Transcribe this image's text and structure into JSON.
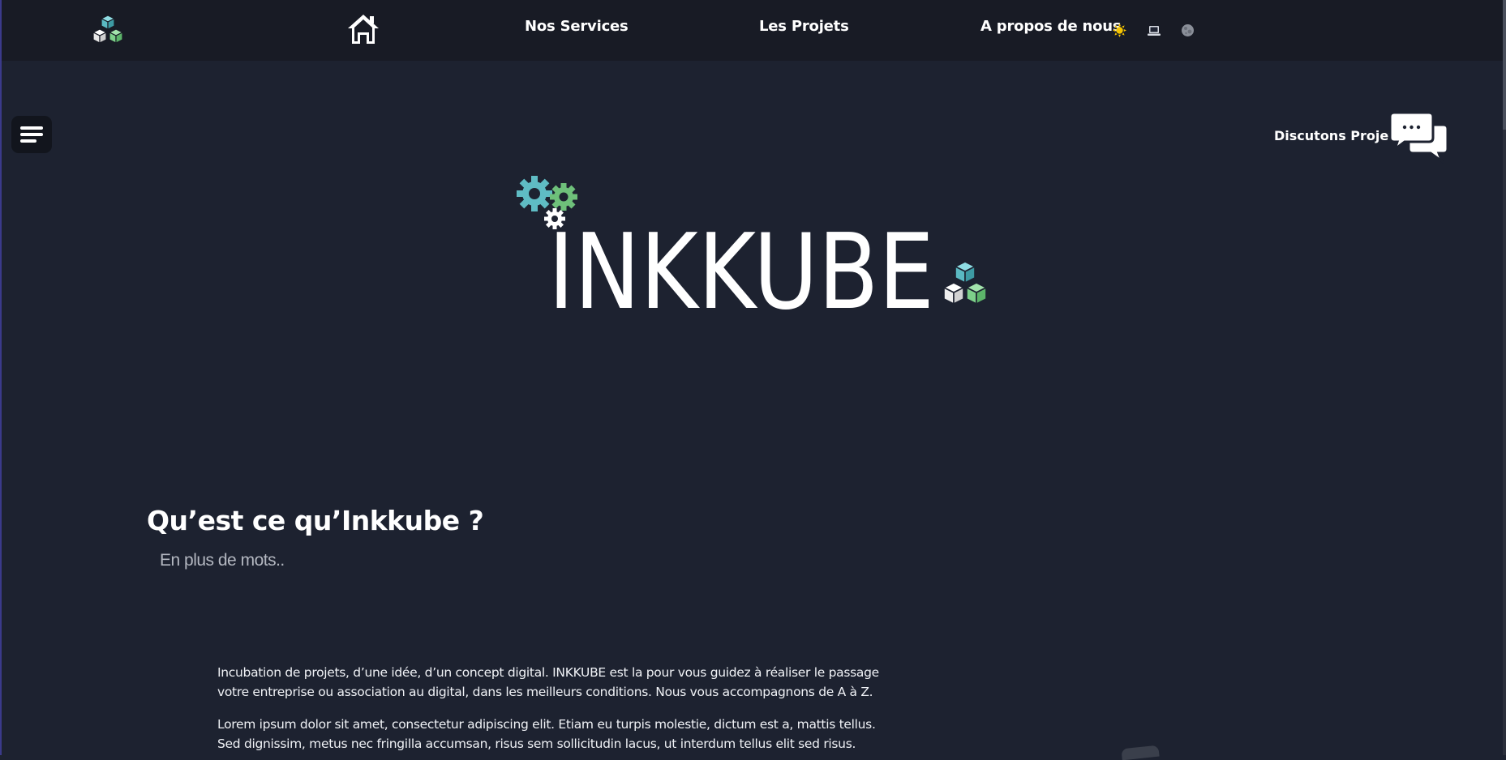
{
  "nav": {
    "logo_icon": "cubes-logo-icon",
    "home_icon": "home-icon",
    "links": [
      "Nos Services",
      "Les Projets",
      "A propos de nous"
    ],
    "theme_icons": [
      "sun-icon",
      "laptop-icon",
      "moon-icon"
    ]
  },
  "menu": {
    "icon": "hamburger-menu-icon"
  },
  "chat": {
    "label": "Discutons Projets",
    "icon": "chat-bubbles-icon"
  },
  "hero": {
    "brand": "INKKUBE",
    "gears_icon": "gears-icon",
    "cubes_icon": "cubes-icon"
  },
  "about": {
    "title": "Qu’est ce qu’Inkkube ?",
    "subtitle": "En plus de mots..",
    "paragraph1_line1": "Incubation de projets, d’une idée, d’un concept digital. INKKUBE est la pour vous guidez à réaliser le passage",
    "paragraph1_line2": "votre entreprise ou association au digital, dans les meilleurs conditions. Nous vous accompagnons de A à Z.",
    "paragraph2_line1": "Lorem ipsum dolor sit amet, consectetur adipiscing elit. Etiam eu turpis molestie, dictum est a, mattis tellus.",
    "paragraph2_line2": "Sed dignissim, metus nec fringilla accumsan, risus sem sollicitudin lacus, ut interdum tellus elit sed risus."
  },
  "colors": {
    "background": "#1d2230",
    "topbar": "#181b25",
    "cube_cyan": "#6cc7cf",
    "cube_green": "#7dd08a",
    "gear_teal": "#5fbcc4",
    "gear_green": "#6ec07a",
    "sun_yellow": "#f5c400"
  }
}
